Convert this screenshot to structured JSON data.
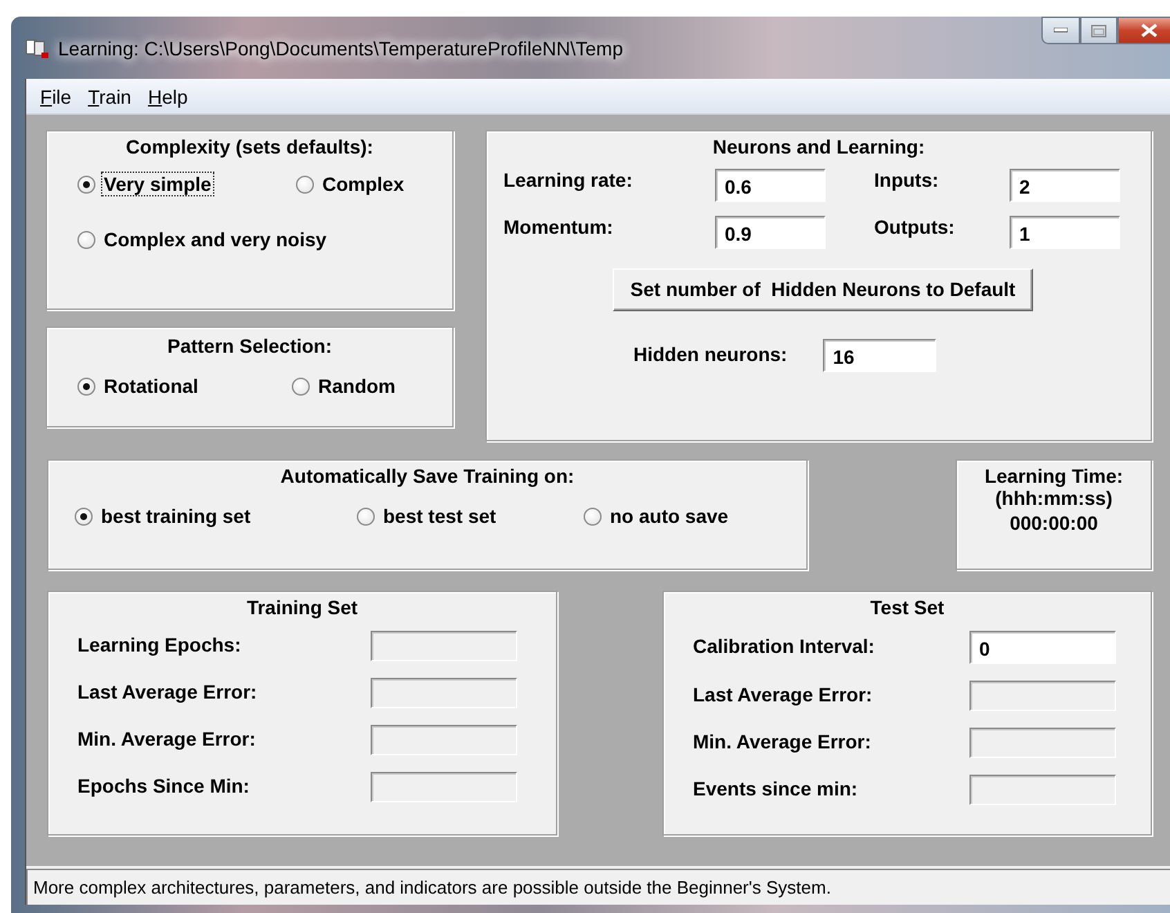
{
  "window": {
    "title": "Learning: C:\\Users\\Pong\\Documents\\TemperatureProfileNN\\Temp"
  },
  "menu": [
    {
      "label": "File"
    },
    {
      "label": "Train"
    },
    {
      "label": "Help"
    }
  ],
  "complexity": {
    "title": "Complexity (sets defaults):",
    "options": [
      {
        "label": "Very simple",
        "selected": true,
        "focused": true
      },
      {
        "label": "Complex",
        "selected": false,
        "focused": false
      },
      {
        "label": "Complex and very noisy",
        "selected": false,
        "focused": false
      }
    ]
  },
  "pattern_selection": {
    "title": "Pattern Selection:",
    "options": [
      {
        "label": "Rotational",
        "selected": true
      },
      {
        "label": "Random",
        "selected": false
      }
    ]
  },
  "neurons_and_learning": {
    "title": "Neurons and Learning:",
    "fields": [
      {
        "label": "Learning rate:",
        "value": "0.6"
      },
      {
        "label": "Inputs:",
        "value": "2"
      },
      {
        "label": "Momentum:",
        "value": "0.9"
      },
      {
        "label": "Outputs:",
        "value": "1"
      }
    ],
    "button": "Set number of  Hidden Neurons to Default",
    "hidden_neurons": {
      "label": "Hidden neurons:",
      "value": "16"
    }
  },
  "auto_save": {
    "title": "Automatically Save Training on:",
    "options": [
      {
        "label": "best training set",
        "selected": true
      },
      {
        "label": "best test set",
        "selected": false
      },
      {
        "label": "no auto save",
        "selected": false
      }
    ]
  },
  "learning_time": {
    "title": "Learning Time:",
    "format": "(hhh:mm:ss)",
    "value": "000:00:00"
  },
  "training_set": {
    "title": "Training Set",
    "rows": [
      {
        "label": "Learning Epochs:",
        "disabled": true
      },
      {
        "label": "Last Average Error:",
        "disabled": true
      },
      {
        "label": "Min. Average Error:",
        "disabled": true
      },
      {
        "label": "Epochs Since Min:",
        "disabled": true
      }
    ]
  },
  "test_set": {
    "title": "Test Set",
    "rows": [
      {
        "label": "Calibration Interval:",
        "value": "0",
        "disabled": false
      },
      {
        "label": "Last Average Error:",
        "disabled": true
      },
      {
        "label": "Min. Average Error:",
        "disabled": true
      },
      {
        "label": "Events since min:",
        "disabled": true
      }
    ]
  },
  "status_bar": {
    "text": "More complex architectures, parameters, and indicators are possible outside the Beginner's System."
  }
}
